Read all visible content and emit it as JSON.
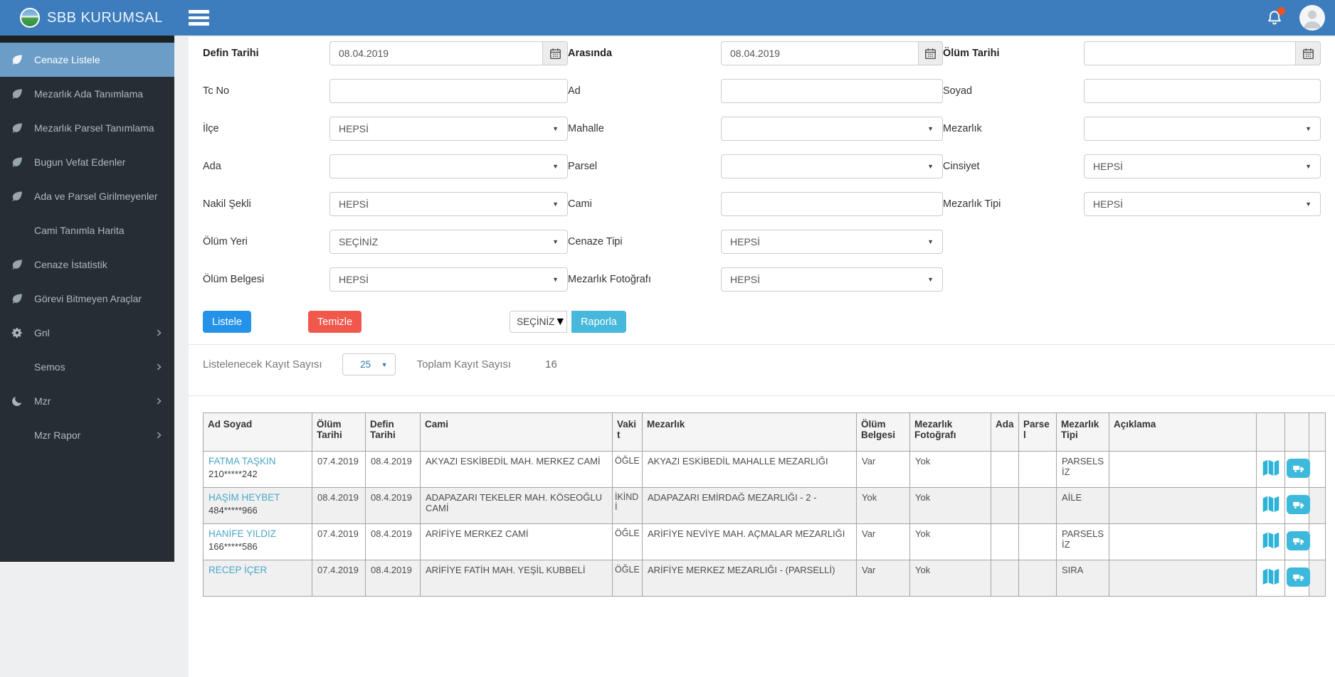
{
  "colors": {
    "header_bar": "#3e7dbd",
    "sidebar_bg": "#262d33",
    "sidebar_active": "#6b9dc7",
    "primary_button": "#2592e9",
    "danger_button": "#f0584c",
    "info_button": "#45b8dc",
    "link": "#4aa7c9",
    "table_icon_cyan": "#2eb3d8",
    "notification_badge": "#f4511e"
  },
  "header": {
    "brand": "SBB KURUMSAL"
  },
  "sidebar": {
    "items": [
      {
        "label": "Cenaze Listele",
        "icon": "leaf",
        "active": true,
        "chevron": false
      },
      {
        "label": "Mezarlık Ada Tanımlama",
        "icon": "leaf",
        "active": false,
        "chevron": false
      },
      {
        "label": "Mezarlık Parsel Tanımlama",
        "icon": "leaf",
        "active": false,
        "chevron": false
      },
      {
        "label": "Bugun Vefat Edenler",
        "icon": "leaf",
        "active": false,
        "chevron": false
      },
      {
        "label": "Ada ve Parsel Girilmeyenler",
        "icon": "leaf",
        "active": false,
        "chevron": false
      },
      {
        "label": "Cami Tanımla Harita",
        "icon": "none",
        "active": false,
        "chevron": false
      },
      {
        "label": "Cenaze İstatistik",
        "icon": "leaf",
        "active": false,
        "chevron": false
      },
      {
        "label": "Görevi Bitmeyen Araçlar",
        "icon": "leaf",
        "active": false,
        "chevron": false
      },
      {
        "label": "Gnl",
        "icon": "gear",
        "active": false,
        "chevron": true
      },
      {
        "label": "Semos",
        "icon": "none",
        "active": false,
        "chevron": true
      },
      {
        "label": "Mzr",
        "icon": "moon",
        "active": false,
        "chevron": true
      },
      {
        "label": "Mzr Rapor",
        "icon": "none",
        "active": false,
        "chevron": true
      }
    ]
  },
  "filters": {
    "defin_tarihi": {
      "label": "Defin Tarihi",
      "value": "08.04.2019"
    },
    "arasinda": {
      "label": "Arasında",
      "value": "08.04.2019"
    },
    "olum_tarihi": {
      "label": "Ölüm Tarihi",
      "value": ""
    },
    "tc_no": {
      "label": "Tc No",
      "value": ""
    },
    "ad": {
      "label": "Ad",
      "value": ""
    },
    "soyad": {
      "label": "Soyad",
      "value": ""
    },
    "ilce": {
      "label": "İlçe",
      "value": "HEPSİ"
    },
    "mahalle": {
      "label": "Mahalle",
      "value": ""
    },
    "mezarlik": {
      "label": "Mezarlık",
      "value": ""
    },
    "ada": {
      "label": "Ada",
      "value": ""
    },
    "parsel": {
      "label": "Parsel",
      "value": ""
    },
    "cinsiyet": {
      "label": "Cinsiyet",
      "value": "HEPSİ"
    },
    "nakil_sekli": {
      "label": "Nakil Şekli",
      "value": "HEPSİ"
    },
    "cami": {
      "label": "Cami",
      "value": ""
    },
    "mezarlik_tipi": {
      "label": "Mezarlık Tipi",
      "value": "HEPSİ"
    },
    "olum_yeri": {
      "label": "Ölüm Yeri",
      "value": "SEÇİNİZ"
    },
    "cenaze_tipi": {
      "label": "Cenaze Tipi",
      "value": "HEPSİ"
    },
    "olum_belgesi": {
      "label": "Ölüm Belgesi",
      "value": "HEPSİ"
    },
    "mezarlik_fotografi": {
      "label": "Mezarlık Fotoğrafı",
      "value": "HEPSİ"
    }
  },
  "actions": {
    "listele": "Listele",
    "temizle": "Temizle",
    "report_select": "SEÇİNİZ",
    "raporla": "Raporla"
  },
  "summary": {
    "page_size_label": "Listelenecek Kayıt Sayısı",
    "page_size": "25",
    "total_label": "Toplam Kayıt Sayısı",
    "total_value": "16"
  },
  "table": {
    "columns": [
      "Ad Soyad",
      "Ölüm Tarihi",
      "Defin Tarihi",
      "Cami",
      "Vakit",
      "Mezarlık",
      "Ölüm Belgesi",
      "Mezarlık Fotoğrafı",
      "Ada",
      "Parsel",
      "Mezarlık Tipi",
      "Açıklama",
      "",
      "",
      ""
    ],
    "rows": [
      {
        "name": "FATMA TAŞKIN",
        "tc": "210*****242",
        "olum_tarihi": "07.4.2019",
        "defin_tarihi": "08.4.2019",
        "cami": "AKYAZI ESKİBEDİL MAH. MERKEZ CAMİ",
        "vakit": "ÖĞLE",
        "mezarlik": "AKYAZI ESKİBEDİL MAHALLE MEZARLIĞI",
        "olum_belgesi": "Var",
        "mezarlik_fotografi": "Yok",
        "ada": "",
        "parsel": "",
        "mezarlik_tipi": "PARSELSİZ",
        "aciklama": ""
      },
      {
        "name": "HAŞİM HEYBET",
        "tc": "484*****966",
        "olum_tarihi": "08.4.2019",
        "defin_tarihi": "08.4.2019",
        "cami": "ADAPAZARI TEKELER MAH. KÖSEOĞLU CAMİ",
        "vakit": "İKİNDİ",
        "mezarlik": "ADAPAZARI EMİRDAĞ MEZARLIĞI - 2 -",
        "olum_belgesi": "Yok",
        "mezarlik_fotografi": "Yok",
        "ada": "",
        "parsel": "",
        "mezarlik_tipi": "AİLE",
        "aciklama": ""
      },
      {
        "name": "HANİFE YILDIZ",
        "tc": "166*****586",
        "olum_tarihi": "07.4.2019",
        "defin_tarihi": "08.4.2019",
        "cami": "ARİFİYE MERKEZ CAMİ",
        "vakit": "ÖĞLE",
        "mezarlik": "ARİFİYE NEVİYE MAH. AÇMALAR MEZARLIĞI",
        "olum_belgesi": "Var",
        "mezarlik_fotografi": "Yok",
        "ada": "",
        "parsel": "",
        "mezarlik_tipi": "PARSELSİZ",
        "aciklama": ""
      },
      {
        "name": "RECEP İÇER",
        "tc": "",
        "olum_tarihi": "07.4.2019",
        "defin_tarihi": "08.4.2019",
        "cami": "ARİFİYE FATİH MAH. YEŞİL KUBBELİ",
        "vakit": "ÖĞLE",
        "mezarlik": "ARİFİYE MERKEZ MEZARLIĞI - (PARSELLİ)",
        "olum_belgesi": "Var",
        "mezarlik_fotografi": "Yok",
        "ada": "",
        "parsel": "",
        "mezarlik_tipi": "SIRA",
        "aciklama": ""
      }
    ]
  }
}
